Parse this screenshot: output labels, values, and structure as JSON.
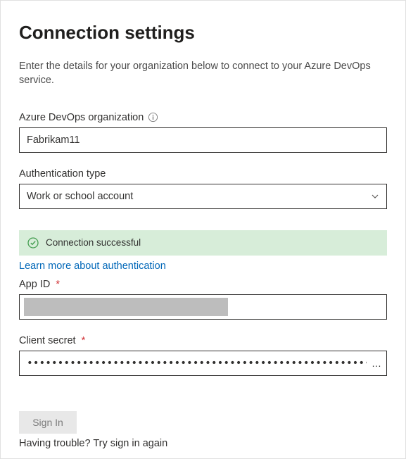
{
  "header": {
    "title": "Connection settings",
    "subtitle": "Enter the details for your organization below to connect to your Azure DevOps service."
  },
  "orgField": {
    "label": "Azure DevOps organization",
    "value": "Fabrikam11"
  },
  "authField": {
    "label": "Authentication type",
    "selected": "Work or school account"
  },
  "status": {
    "message": "Connection successful"
  },
  "learnMore": {
    "text": "Learn more about authentication"
  },
  "appId": {
    "label": "App ID",
    "required": "*"
  },
  "clientSecret": {
    "label": "Client secret",
    "required": "*",
    "value": "••••••••••••••••••••••••••••••••••••••••••••••••••••••••••••••••••••••••••••••••••••••••••"
  },
  "signIn": {
    "label": "Sign In"
  },
  "trouble": {
    "text": "Having trouble? Try sign in again"
  }
}
